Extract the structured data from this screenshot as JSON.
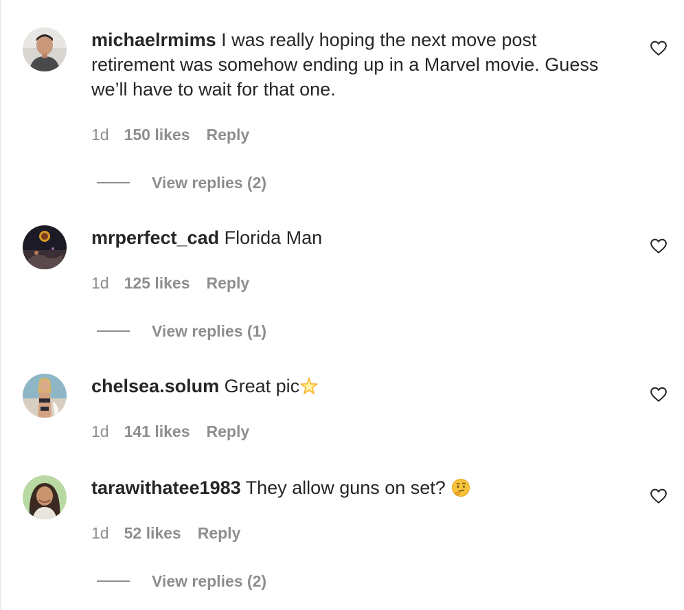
{
  "comments": [
    {
      "username": "michaelrmims",
      "text": "I was really hoping the next move post retirement was somehow ending up in a Marvel movie. Guess we’ll have to wait for that one.",
      "time": "1d",
      "likes": "150 likes",
      "reply_label": "Reply",
      "view_replies": "View replies (2)"
    },
    {
      "username": "mrperfect_cad",
      "text": "Florida Man",
      "time": "1d",
      "likes": "125 likes",
      "reply_label": "Reply",
      "view_replies": "View replies (1)"
    },
    {
      "username": "chelsea.solum",
      "text": "Great pic",
      "emoji": "glowing-star-emoji",
      "time": "1d",
      "likes": "141 likes",
      "reply_label": "Reply"
    },
    {
      "username": "tarawithatee1983",
      "text": "They allow guns on set?",
      "emoji": "thinking-face-emoji",
      "time": "1d",
      "likes": "52 likes",
      "reply_label": "Reply",
      "view_replies": "View replies (2)"
    }
  ],
  "icons": {
    "like": "heart-outline-icon"
  },
  "colors": {
    "text_primary": "#262626",
    "text_secondary": "#8e8e8e"
  }
}
